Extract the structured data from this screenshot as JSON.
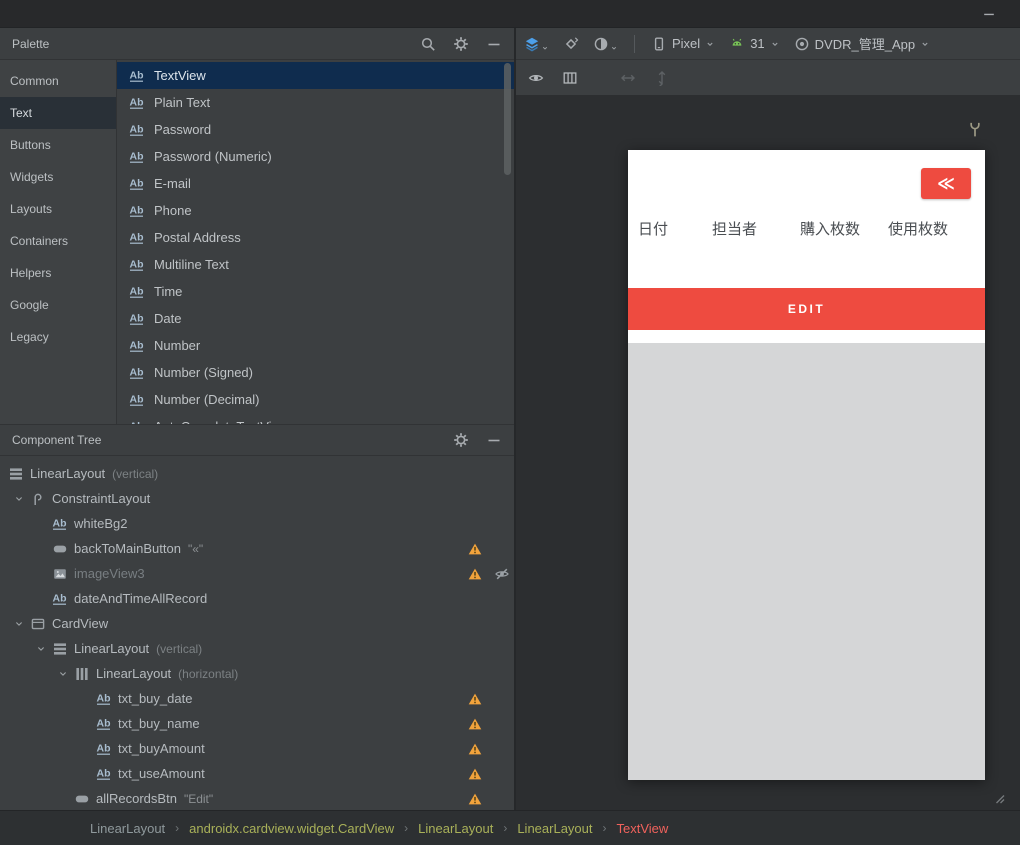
{
  "palette": {
    "title": "Palette",
    "selected_category": "Text",
    "categories": [
      "Common",
      "Text",
      "Buttons",
      "Widgets",
      "Layouts",
      "Containers",
      "Helpers",
      "Google",
      "Legacy"
    ],
    "selected_item": "TextView",
    "items": [
      "TextView",
      "Plain Text",
      "Password",
      "Password (Numeric)",
      "E-mail",
      "Phone",
      "Postal Address",
      "Multiline Text",
      "Time",
      "Date",
      "Number",
      "Number (Signed)",
      "Number (Decimal)",
      "AutoCompleteTextView"
    ]
  },
  "design_toolbar": {
    "device_label": "Pixel",
    "api_label": "31",
    "theme_label": "DVDR_管理_App"
  },
  "component_tree": {
    "title": "Component Tree",
    "nodes": [
      {
        "depth": 0,
        "icon": "linearV",
        "label": "LinearLayout",
        "hint": "(vertical)"
      },
      {
        "depth": 1,
        "icon": "constraint",
        "label": "ConstraintLayout",
        "chevron": true
      },
      {
        "depth": 2,
        "icon": "ab",
        "label": "whiteBg2"
      },
      {
        "depth": 2,
        "icon": "button",
        "label": "backToMainButton",
        "quote": "\"«\"",
        "warning": true
      },
      {
        "depth": 2,
        "icon": "image",
        "label": "imageView3",
        "warning": true,
        "hidden_eye": true,
        "dim": true
      },
      {
        "depth": 2,
        "icon": "ab",
        "label": "dateAndTimeAllRecord"
      },
      {
        "depth": 1,
        "icon": "card",
        "label": "CardView",
        "chevron": true
      },
      {
        "depth": 2,
        "icon": "linearV",
        "label": "LinearLayout",
        "hint": "(vertical)",
        "chevron": true
      },
      {
        "depth": 3,
        "icon": "linearH",
        "label": "LinearLayout",
        "hint": "(horizontal)",
        "chevron": true
      },
      {
        "depth": 4,
        "icon": "ab",
        "label": "txt_buy_date",
        "warning": true
      },
      {
        "depth": 4,
        "icon": "ab",
        "label": "txt_buy_name",
        "warning": true
      },
      {
        "depth": 4,
        "icon": "ab",
        "label": "txt_buyAmount",
        "warning": true
      },
      {
        "depth": 4,
        "icon": "ab",
        "label": "txt_useAmount",
        "warning": true
      },
      {
        "depth": 3,
        "icon": "button",
        "label": "allRecordsBtn",
        "quote": "\"Edit\"",
        "warning": true
      }
    ]
  },
  "preview": {
    "back_button_label": "≪",
    "table_headers": [
      "日付",
      "担当者",
      "購入枚数",
      "使用枚数"
    ],
    "edit_button_label": "EDIT"
  },
  "breadcrumbs": {
    "separator": "›",
    "items": [
      {
        "label": "LinearLayout",
        "style": "muted"
      },
      {
        "label": "androidx.cardview.widget.CardView",
        "style": "tag"
      },
      {
        "label": "LinearLayout",
        "style": "tag"
      },
      {
        "label": "LinearLayout",
        "style": "tag"
      },
      {
        "label": "TextView",
        "style": "current"
      }
    ]
  },
  "icons": {
    "palette_header": [
      "search-icon",
      "settings-icon",
      "minimize-icon"
    ],
    "tree_header": [
      "settings-icon",
      "minimize-icon"
    ],
    "design_toolbar": [
      "layers-icon",
      "orientation-icon",
      "night-mode-icon",
      "phone-icon",
      "android-icon",
      "theme-ring-icon"
    ],
    "view_toolbar": [
      "view-options-eye-icon",
      "layout-columns-icon",
      "pan-horizontal-icon",
      "pan-vertical-icon"
    ],
    "tree_rows": [
      "warning-icon",
      "visibility-off-icon",
      "chevron-down-icon"
    ]
  },
  "colors": {
    "accent_red": "#ee4b40",
    "warning_orange": "#f2a33c",
    "selection_navy": "#0f2c4e",
    "android_green": "#78c257",
    "layers_blue": "#4d9fe8"
  }
}
